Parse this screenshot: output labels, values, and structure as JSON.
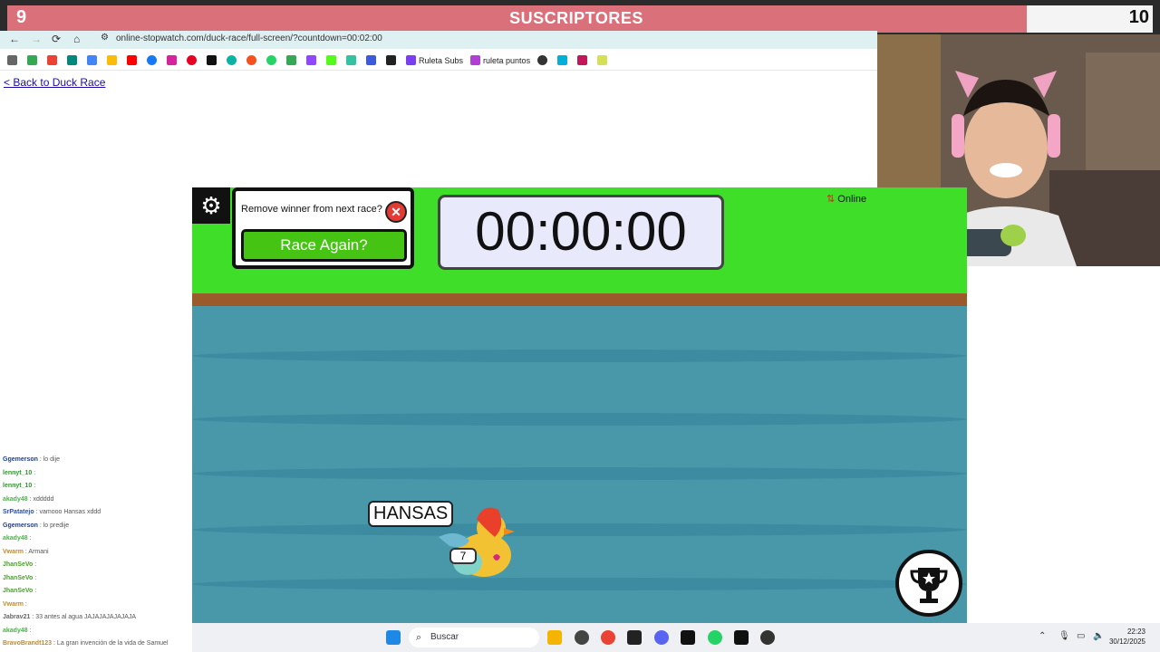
{
  "overlay": {
    "left_count": "9",
    "title": "SUSCRIPTORES",
    "right_count": "10"
  },
  "browser": {
    "url": "online-stopwatch.com/duck-race/full-screen/?countdown=00:02:00"
  },
  "bookmarks": [
    {
      "label": "Ruleta Subs",
      "color": "#7b3ff2"
    },
    {
      "label": "ruleta puntos",
      "color": "#b13fd6"
    }
  ],
  "page": {
    "back_link": "< Back to Duck Race"
  },
  "game": {
    "remove_prompt": "Remove winner from next race?",
    "race_again": "Race Again?",
    "timer": "00:00:00",
    "online": "Online",
    "duck_name": "HANSAS",
    "duck_number": "7"
  },
  "chat": [
    {
      "user": "Ggemerson",
      "msg": "lo dije",
      "color": "#1f3f8f"
    },
    {
      "user": "lennyt_10",
      "msg": "",
      "color": "#2a9a2a"
    },
    {
      "user": "lennyt_10",
      "msg": "",
      "color": "#2a9a2a"
    },
    {
      "user": "akady48",
      "msg": "xddddd",
      "color": "#4bb44b"
    },
    {
      "user": "SrPatatejo",
      "msg": "vamooo Hansas xddd",
      "color": "#2c4fa3"
    },
    {
      "user": "Ggemerson",
      "msg": "lo predije",
      "color": "#1f3f8f"
    },
    {
      "user": "akady48",
      "msg": "",
      "color": "#4bb44b"
    },
    {
      "user": "Vwarm",
      "msg": "Armani",
      "color": "#c08a2b"
    },
    {
      "user": "JhanSeVo",
      "msg": "",
      "color": "#4aa02a"
    },
    {
      "user": "JhanSeVo",
      "msg": "",
      "color": "#4aa02a"
    },
    {
      "user": "JhanSeVo",
      "msg": "",
      "color": "#4aa02a"
    },
    {
      "user": "Vwarm",
      "msg": "",
      "color": "#c08a2b"
    },
    {
      "user": "Jabrav21",
      "msg": "33 antes al agua JAJAJAJAJAJAJA",
      "color": "#666"
    },
    {
      "user": "akady48",
      "msg": "",
      "color": "#4bb44b"
    },
    {
      "user": "BravoBrandt123",
      "msg": "La gran invención de la vida de Samuel",
      "color": "#c08a2b"
    }
  ],
  "taskbar": {
    "search": "Buscar",
    "time": "22:23",
    "date": "30/12/2025"
  }
}
